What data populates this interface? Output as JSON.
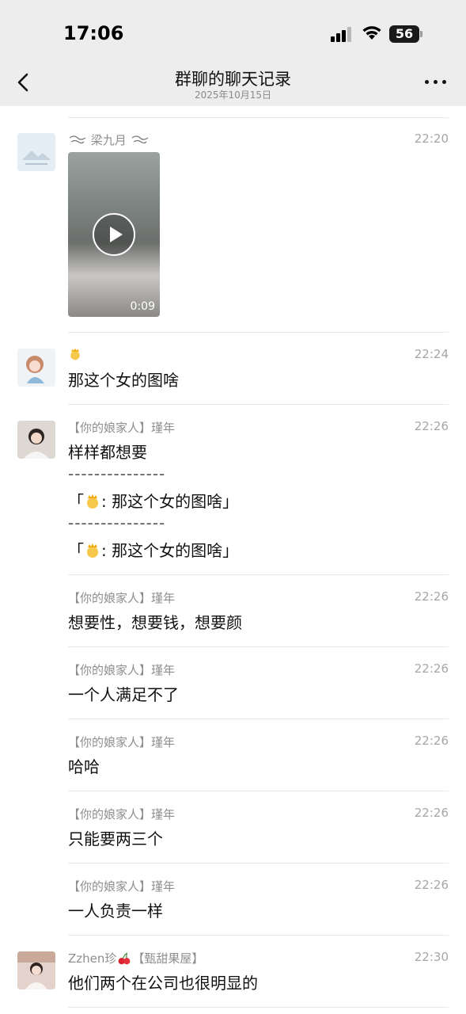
{
  "status": {
    "time": "17:06",
    "battery": "56"
  },
  "nav": {
    "title": "群聊的聊天记录",
    "subtitle": "2025年10月15日"
  },
  "messages": [
    {
      "sender": "梁九月",
      "time": "22:20",
      "video_duration": "0:09"
    },
    {
      "time": "22:24",
      "text": "那这个女的图啥"
    },
    {
      "sender": "【你的娘家人】瑾年",
      "time": "22:26",
      "text": "样样都想要",
      "sep1": "---------------",
      "quote1_open": "「",
      "quote1_text": ": 那这个女的图啥」",
      "sep2": "---------------",
      "quote2_open": "「",
      "quote2_text": ": 那这个女的图啥」"
    },
    {
      "sender": "【你的娘家人】瑾年",
      "time": "22:26",
      "text": "想要性，想要钱，想要颜"
    },
    {
      "sender": "【你的娘家人】瑾年",
      "time": "22:26",
      "text": "一个人满足不了"
    },
    {
      "sender": "【你的娘家人】瑾年",
      "time": "22:26",
      "text": "哈哈"
    },
    {
      "sender": "【你的娘家人】瑾年",
      "time": "22:26",
      "text": "只能要两三个"
    },
    {
      "sender": "【你的娘家人】瑾年",
      "time": "22:26",
      "text": "一人负责一样"
    },
    {
      "sender_prefix": "Zzhen珍",
      "sender_suffix": "【甄甜果屋】",
      "time": "22:30",
      "text": "他们两个在公司也很明显的"
    }
  ],
  "icons": {
    "back": "chevron-left-icon",
    "more": "more-dots-icon",
    "crown_emoji": "crown-emoji-icon",
    "cherry_emoji": "cherry-emoji-icon"
  }
}
